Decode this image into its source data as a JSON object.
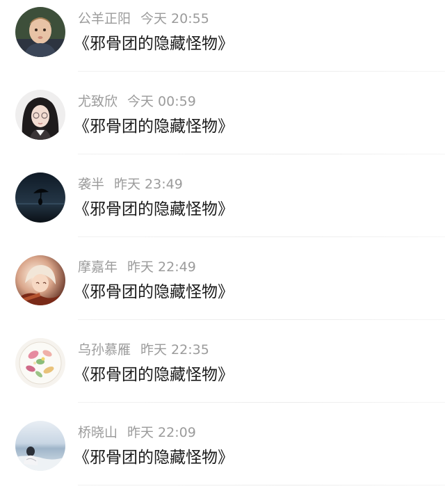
{
  "comments": [
    {
      "user": "公羊正阳",
      "time": "今天 20:55",
      "message": "《邪骨团的隐藏怪物》",
      "avatar": "child-photo-avatar"
    },
    {
      "user": "尤致欣",
      "time": "今天 00:59",
      "message": "《邪骨团的隐藏怪物》",
      "avatar": "girl-with-glasses-avatar"
    },
    {
      "user": "袭半",
      "time": "昨天 23:49",
      "message": "《邪骨团的隐藏怪物》",
      "avatar": "dark-night-umbrella-avatar"
    },
    {
      "user": "摩嘉年",
      "time": "昨天 22:49",
      "message": "《邪骨团的隐藏怪物》",
      "avatar": "anime-girl-avatar"
    },
    {
      "user": "乌孙慕雁",
      "time": "昨天 22:35",
      "message": "《邪骨团的隐藏怪物》",
      "avatar": "flower-plate-avatar"
    },
    {
      "user": "桥晓山",
      "time": "昨天 22:09",
      "message": "《邪骨团的隐藏怪物》",
      "avatar": "seaside-person-avatar"
    }
  ]
}
